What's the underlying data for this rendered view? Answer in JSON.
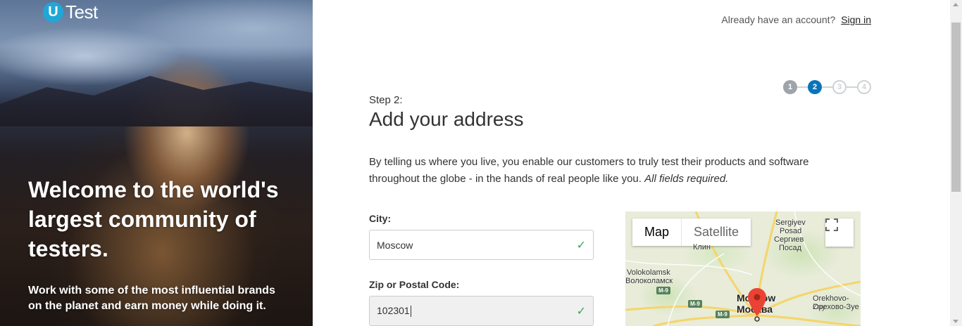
{
  "brand": {
    "logo_letter": "U",
    "logo_text": "Test",
    "accent": "#21a6d8"
  },
  "hero": {
    "headline": "Welcome to the world's largest community of testers.",
    "subtext": "Work with some of the most influential brands on the planet and earn money while doing it."
  },
  "header": {
    "account_prompt": "Already have an account?",
    "sign_in_label": "Sign in"
  },
  "progress": {
    "current_step": 2,
    "steps": [
      "1",
      "2",
      "3",
      "4"
    ],
    "active_color": "#0a74b8"
  },
  "form": {
    "step_label": "Step 2:",
    "title": "Add your address",
    "intro_text": "By telling us where you live, you enable our customers to truly test their products and software throughout the globe - in the hands of real people like you.",
    "intro_required": "All fields required.",
    "city": {
      "label": "City:",
      "value": "Moscow"
    },
    "zip": {
      "label": "Zip or Postal Code:",
      "value": "102301"
    }
  },
  "map": {
    "type_map_label": "Map",
    "type_satellite_label": "Satellite",
    "places": {
      "sergiyev_en": "Sergiyev",
      "sergiyev_en2": "Posad",
      "sergiyev_ru": "Сергиев",
      "sergiyev_ru2": "Посад",
      "klin": "Клин",
      "volokolamsk_en": "Volokolamsk",
      "volokolamsk_ru": "Волоколамск",
      "moscow_en": "Moscow",
      "moscow_ru": "Москва",
      "orekhovo_en": "Orekhovo-Zuy",
      "orekhovo_ru": "Орехово-Зуе"
    },
    "roads": [
      "M-9",
      "M-9",
      "M-9"
    ]
  }
}
